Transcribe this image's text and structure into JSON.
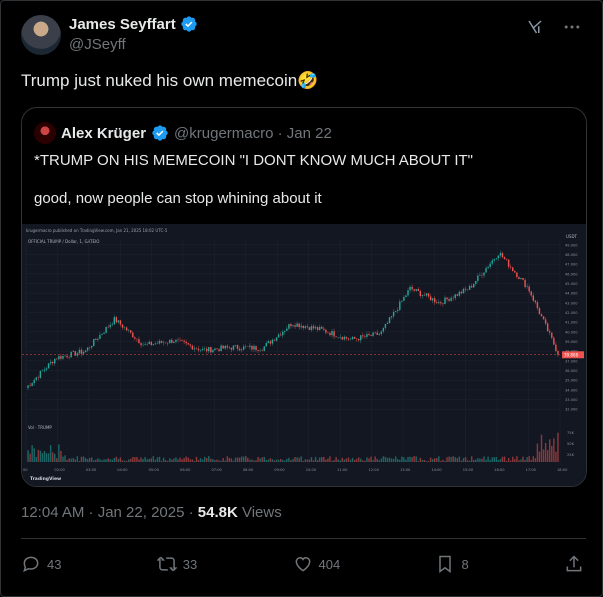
{
  "author": {
    "name": "James Seyffart",
    "handle": "@JSeyff"
  },
  "tweet": {
    "text": "Trump just nuked his own memecoin🤣"
  },
  "quote": {
    "name": "Alex Krüger",
    "handle_date": "@krugermacro · Jan 22",
    "line1": "*TRUMP ON HIS MEMECOIN \"I DONT KNOW MUCH ABOUT IT\"",
    "line2": "good, now people can stop whining about it"
  },
  "chart": {
    "header": "krugermacro published on TradingView.com, Jan 21, 2025 18:02 UTC-5",
    "symbol": "OFFICIAL TRUMP / Dollar, 1, GATEIO",
    "vol_label": "Vol · TRUMP",
    "price_tag": "39.808",
    "brand": "TradingView",
    "currency": "USDT",
    "y_ticks": [
      "49.000",
      "48.000",
      "47.000",
      "46.000",
      "45.000",
      "44.000",
      "43.000",
      "42.000",
      "41.000",
      "40.000",
      "39.000",
      "38.000",
      "37.000",
      "36.000",
      "35.000",
      "34.000",
      "33.000",
      "32.000"
    ],
    "x_ticks": [
      "00",
      "02:00",
      "03:00",
      "04:00",
      "05:00",
      "06:00",
      "07:00",
      "08:00",
      "09:00",
      "10:00",
      "11:00",
      "12:00",
      "13:00",
      "14:00",
      "15:00",
      "16:00",
      "17:00",
      "18:00"
    ],
    "vol_ticks": [
      "75K",
      "50K",
      "25K"
    ],
    "colors": {
      "up": "#26a69a",
      "down": "#ef5350",
      "bg": "#131722"
    }
  },
  "chart_data": {
    "type": "line",
    "title": "OFFICIAL TRUMP / Dollar, 1, GATEIO",
    "xlabel": "",
    "ylabel": "USDT",
    "ylim": [
      31.5,
      49.5
    ],
    "x": [
      "00",
      "02:00",
      "03:00",
      "04:00",
      "05:00",
      "06:00",
      "07:00",
      "08:00",
      "09:00",
      "10:00",
      "11:00",
      "12:00",
      "13:00",
      "14:00",
      "15:00",
      "16:00",
      "17:00",
      "18:00",
      "18:02"
    ],
    "series": [
      {
        "values": [
          34.2,
          37.3,
          38.0,
          41.3,
          38.6,
          39.1,
          38.1,
          38.4,
          38.3,
          40.9,
          40.2,
          39.2,
          39.8,
          44.5,
          43.0,
          44.5,
          48.2,
          44.5,
          37.8
        ]
      }
    ]
  },
  "meta": {
    "time": "12:04 AM · Jan 22, 2025 · ",
    "views_count": "54.8K",
    "views_label": " Views"
  },
  "actions": {
    "replies": "43",
    "reposts": "33",
    "likes": "404",
    "bookmarks": "8"
  }
}
